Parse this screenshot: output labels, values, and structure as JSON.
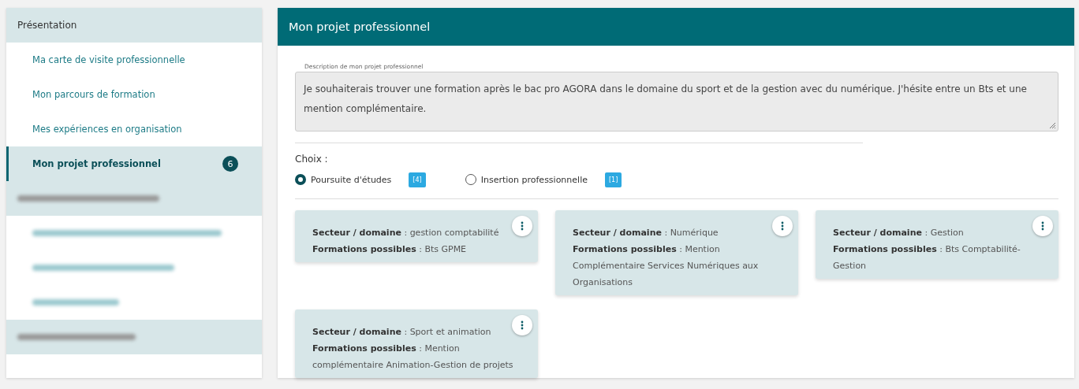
{
  "sidebar": {
    "sections": [
      {
        "title": "Présentation",
        "blurred": false,
        "items": [
          {
            "label": "Ma carte de visite professionnelle",
            "selected": false,
            "blurred": false
          },
          {
            "label": "Mon parcours de formation",
            "selected": false,
            "blurred": false
          },
          {
            "label": "Mes expériences en organisation",
            "selected": false,
            "blurred": false
          },
          {
            "label": "Mon projet professionnel",
            "selected": true,
            "blurred": false,
            "badge": "6"
          }
        ]
      },
      {
        "blurred": true,
        "items": [
          {
            "selected": false,
            "blurred": true
          },
          {
            "selected": false,
            "blurred": true
          },
          {
            "selected": false,
            "blurred": true
          }
        ]
      },
      {
        "blurred": true
      }
    ]
  },
  "panel": {
    "title": "Mon projet professionnel",
    "description": {
      "label": "Description de mon projet professionnel",
      "value": "Je souhaiterais trouver une formation après le bac pro AGORA dans le domaine du sport et de la gestion avec du numérique.  J'hésite entre un Bts et une mention complémentaire."
    },
    "choice": {
      "label": "Choix :",
      "options": [
        {
          "label": "Poursuite d'études",
          "selected": true,
          "count": "[4]"
        },
        {
          "label": "Insertion professionnelle",
          "selected": false,
          "count": "[1]"
        }
      ]
    },
    "cards": [
      {
        "lines": [
          "**Secteur / domaine** : gestion comptabilité",
          "**Formations possibles** : Bts GPME"
        ]
      },
      {
        "lines": [
          "**Secteur / domaine** : Numérique",
          "**Formations possibles** : Mention Complémentaire Services Numériques aux Organisations"
        ]
      },
      {
        "lines": [
          "**Secteur / domaine** : Gestion",
          "**Formations possibles** : Bts Comptabilité-Gestion"
        ]
      },
      {
        "lines": [
          "**Secteur / domaine** : Sport et animation",
          "**Formations possibles** : Mention complémentaire Animation-Gestion de projets"
        ]
      }
    ]
  }
}
